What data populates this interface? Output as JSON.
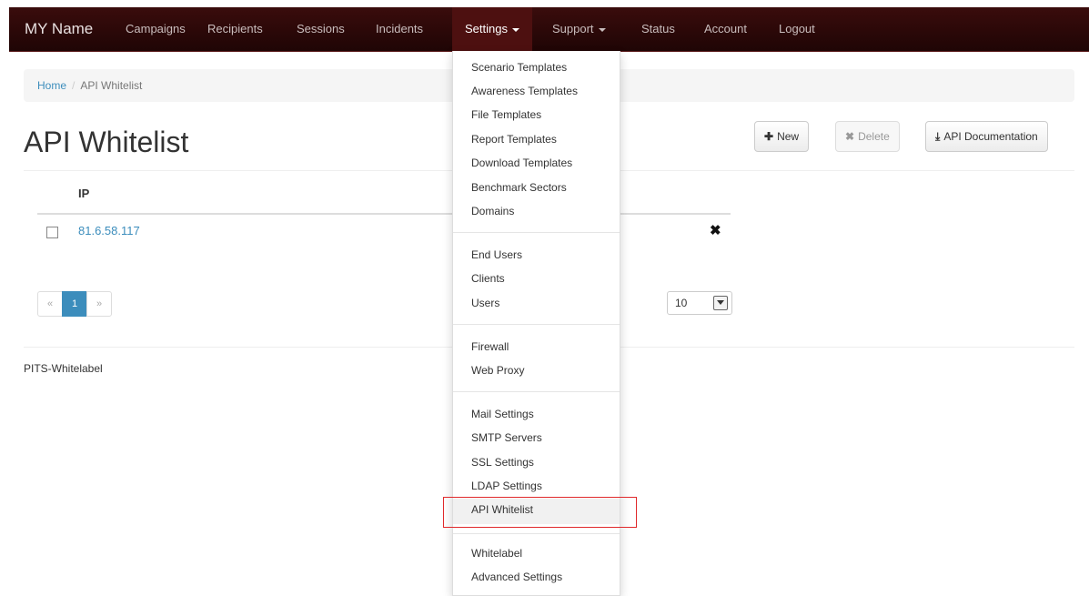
{
  "navbar": {
    "brand": "MY Name",
    "items": [
      {
        "label": "Campaigns"
      },
      {
        "label": "Recipients"
      },
      {
        "label": "Sessions"
      },
      {
        "label": "Incidents"
      },
      {
        "label": "Settings"
      },
      {
        "label": "Support"
      },
      {
        "label": "Status"
      },
      {
        "label": "Account"
      },
      {
        "label": "Logout"
      }
    ]
  },
  "breadcrumb": {
    "home": "Home",
    "separator": "/",
    "current": "API Whitelist"
  },
  "page": {
    "title": "API Whitelist"
  },
  "toolbar": {
    "new_label": "New",
    "delete_label": "Delete",
    "docs_label": "API Documentation"
  },
  "table": {
    "columns": [
      "IP"
    ],
    "rows": [
      {
        "ip": "81.6.58.117",
        "delete_icon": "times-icon"
      }
    ]
  },
  "pagination": {
    "prev": "«",
    "current": "1",
    "next": "»",
    "page_size": "10"
  },
  "footer": {
    "text": "PITS-Whitelabel"
  },
  "settings_menu": {
    "groups": [
      [
        "Scenario Templates",
        "Awareness Templates",
        "File Templates",
        "Report Templates",
        "Download Templates",
        "Benchmark Sectors",
        "Domains"
      ],
      [
        "End Users",
        "Clients",
        "Users"
      ],
      [
        "Firewall",
        "Web Proxy"
      ],
      [
        "Mail Settings",
        "SMTP Servers",
        "SSL Settings",
        "LDAP Settings",
        "API Whitelist"
      ],
      [
        "Whitelabel",
        "Advanced Settings"
      ]
    ],
    "highlighted": "API Whitelist"
  },
  "colors": {
    "navbar": "#2a0707",
    "link": "#3c8dbc",
    "highlight_border": "#e0292b"
  }
}
